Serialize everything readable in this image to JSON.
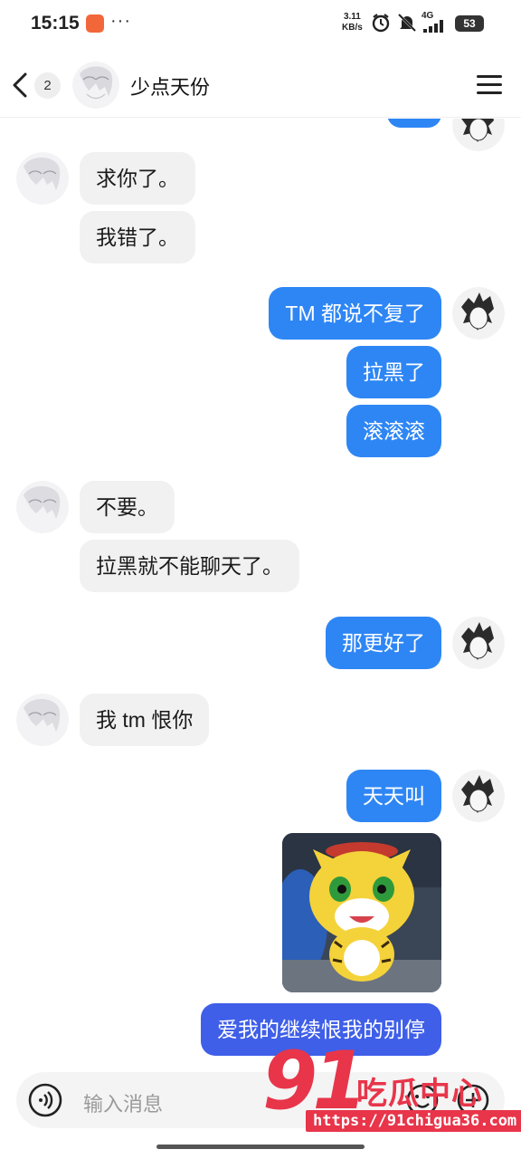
{
  "status_bar": {
    "time": "15:15",
    "dots": "···",
    "net_speed_value": "3.11",
    "net_speed_unit": "KB/s",
    "network": "4G",
    "battery": "53"
  },
  "header": {
    "unread_count": "2",
    "contact_name": "少点天份"
  },
  "messages": [
    {
      "from": "other",
      "text": "求你了。"
    },
    {
      "from": "other",
      "text": "我错了。"
    },
    {
      "from": "me",
      "text": "TM 都说不复了"
    },
    {
      "from": "me",
      "text": "拉黑了"
    },
    {
      "from": "me",
      "text": "滚滚滚"
    },
    {
      "from": "other",
      "text": "不要。"
    },
    {
      "from": "other",
      "text": "拉黑就不能聊天了。"
    },
    {
      "from": "me",
      "text": "那更好了"
    },
    {
      "from": "other",
      "text": "我 tm 恨你"
    },
    {
      "from": "me",
      "text": "天天叫"
    },
    {
      "from": "me",
      "type": "sticker",
      "sticker": "yellow-tiger-cartoon"
    },
    {
      "from": "me",
      "text": "爱我的继续恨我的别停"
    }
  ],
  "input": {
    "placeholder": "输入消息"
  },
  "watermark": {
    "number": "91",
    "brand": "吃瓜中心",
    "url": "https://91chigua36.com"
  },
  "colors": {
    "outgoing_bubble": "#2e86f5",
    "outgoing_bubble_last": "#3f5fe8",
    "incoming_bubble": "#f1f1f1",
    "watermark": "#e8354a"
  },
  "icons": [
    "back-arrow-icon",
    "menu-icon",
    "voice-icon",
    "emoji-icon",
    "plus-icon",
    "alarm-icon",
    "mute-icon",
    "signal-icon",
    "battery-icon"
  ]
}
